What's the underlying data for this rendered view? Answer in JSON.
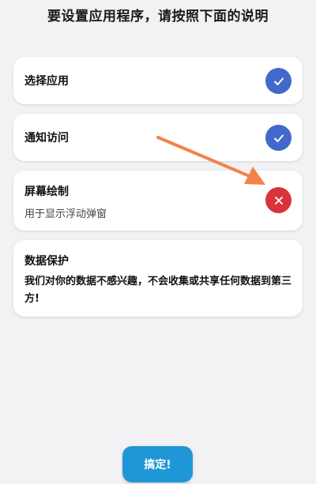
{
  "header": {
    "title": "要设置应用程序，请按照下面的说明"
  },
  "steps": [
    {
      "title": "选择应用",
      "status": "done",
      "status_icon": "check-icon"
    },
    {
      "title": "通知访问",
      "status": "done",
      "status_icon": "check-icon"
    },
    {
      "title": "屏幕绘制",
      "subtitle": "用于显示浮动弹窗",
      "status": "not-granted",
      "status_icon": "close-icon"
    }
  ],
  "privacy": {
    "title": "数据保护",
    "text": "我们对你的数据不感兴趣，不会收集或共享任何数据到第三方!"
  },
  "action": {
    "button_label": "搞定!"
  },
  "colors": {
    "done": "#4169c9",
    "not_granted": "#d9343c",
    "arrow": "#f2834a",
    "button": "#1f97d6"
  }
}
